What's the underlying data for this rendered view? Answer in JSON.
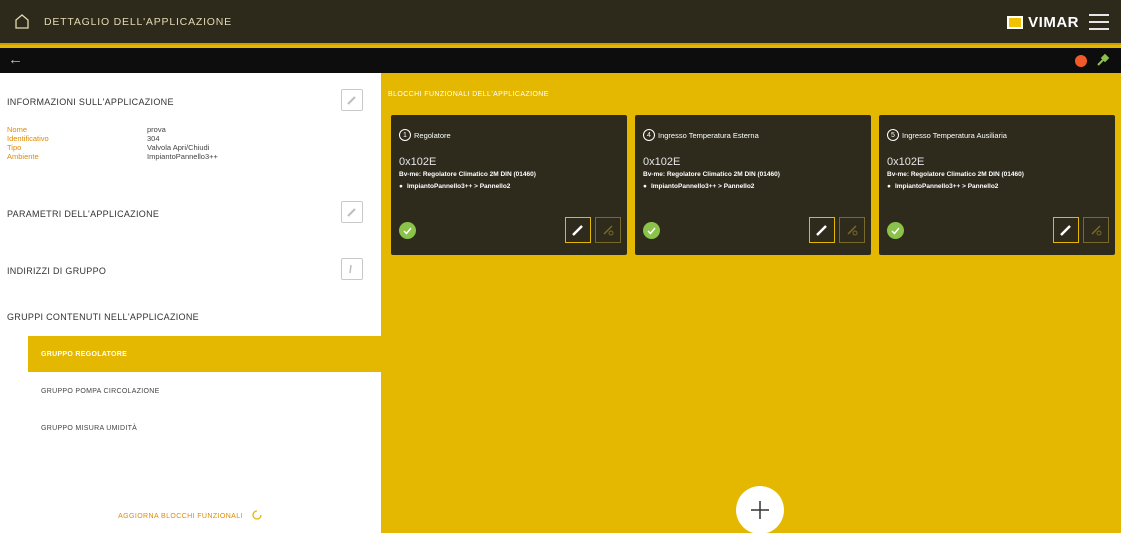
{
  "header": {
    "title": "DETTAGLIO DELL'APPLICAZIONE",
    "brand": "VIMAR"
  },
  "left": {
    "info_title": "INFORMAZIONI SULL'APPLICAZIONE",
    "info": [
      {
        "key": "Nome",
        "value": "prova"
      },
      {
        "key": "Identificativo",
        "value": "304"
      },
      {
        "key": "Tipo",
        "value": "Valvola Apri/Chiudi"
      },
      {
        "key": "Ambiente",
        "value": "ImpiantoPannello3++"
      }
    ],
    "params_title": "PARAMETRI DELL'APPLICAZIONE",
    "addresses_title": "INDIRIZZI DI GRUPPO",
    "groups_title": "GRUPPI CONTENUTI NELL'APPLICAZIONE",
    "groups": [
      {
        "label": "GRUPPO REGOLATORE"
      },
      {
        "label": "GRUPPO POMPA CIRCOLAZIONE"
      },
      {
        "label": "GRUPPO MISURA UMIDITÀ"
      }
    ],
    "update_label": "AGGIORNA BLOCCHI FUNZIONALI"
  },
  "right": {
    "title": "BLOCCHI FUNZIONALI DELL'APPLICAZIONE",
    "cards": [
      {
        "num": "1",
        "name": "Regolatore",
        "address": "0x102E",
        "device": "Bv-me: Regolatore Climatico 2M DIN (01460)",
        "location": "ImpiantoPannello3++ > Pannello2"
      },
      {
        "num": "4",
        "name": "Ingresso Temperatura Esterna",
        "address": "0x102E",
        "device": "Bv-me: Regolatore Climatico 2M DIN (01460)",
        "location": "ImpiantoPannello3++ > Pannello2"
      },
      {
        "num": "5",
        "name": "Ingresso Temperatura Ausiliaria",
        "address": "0x102E",
        "device": "Bv-me: Regolatore Climatico 2M DIN (01460)",
        "location": "ImpiantoPannello3++ > Pannello2"
      }
    ]
  },
  "colors": {
    "accent": "#e4b800",
    "card_bg": "#2e2b1d",
    "ok_green": "#8bc34a",
    "alert_red": "#f05a28"
  }
}
